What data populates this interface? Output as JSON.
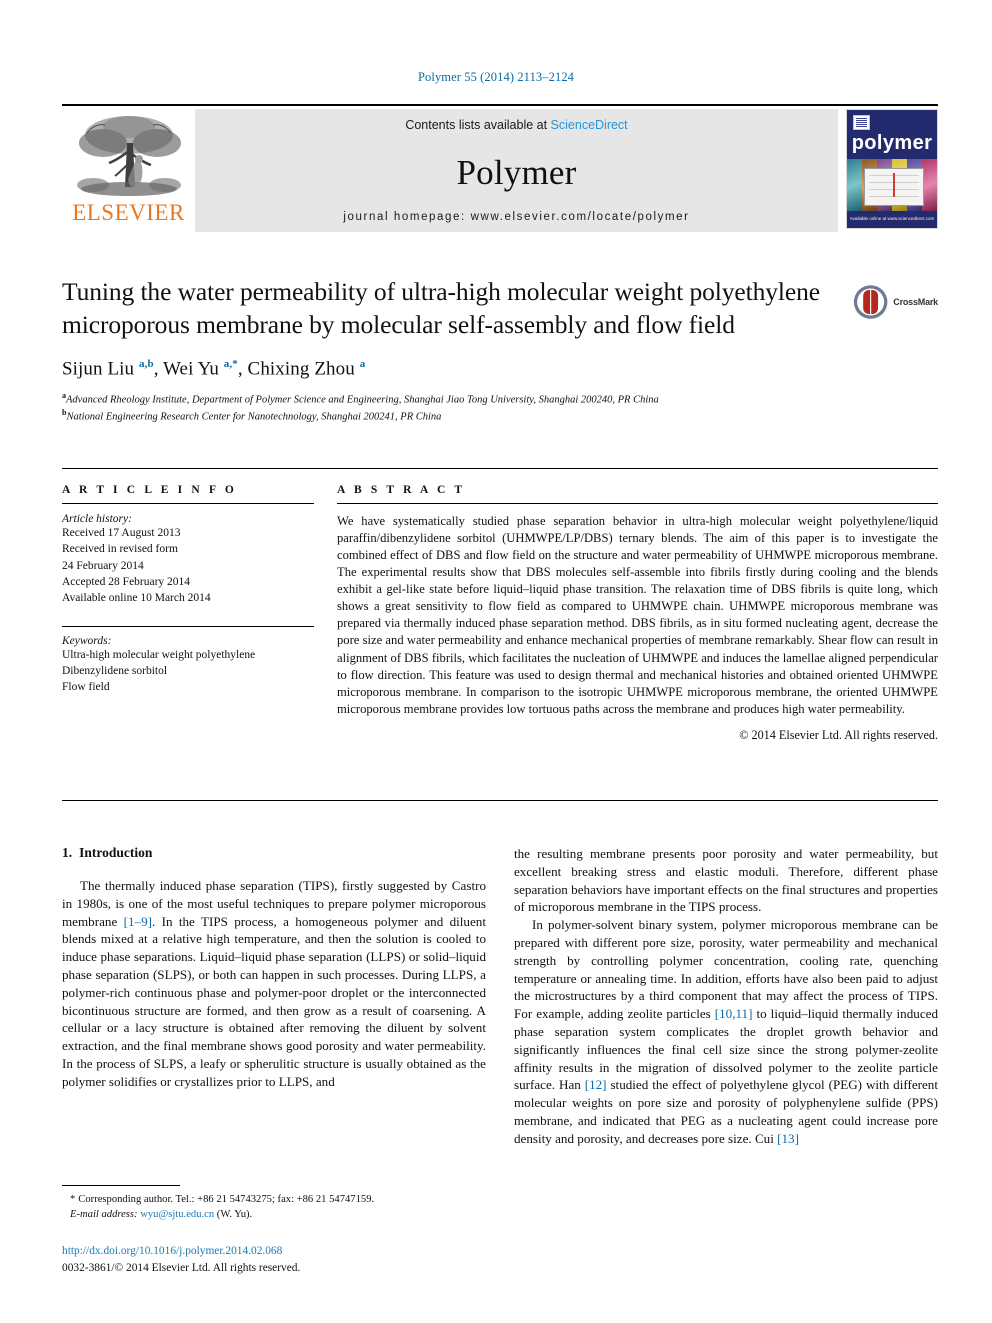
{
  "running_head": "Polymer 55 (2014) 2113–2124",
  "masthead": {
    "publisher_name": "ELSEVIER",
    "contents_prefix": "Contents lists available at ",
    "contents_link": "ScienceDirect",
    "journal_name": "Polymer",
    "homepage": "journal homepage: www.elsevier.com/locate/polymer",
    "cover_title": "polymer",
    "cover_footer": "Available online at www.sciencedirect.com"
  },
  "article": {
    "title": "Tuning the water permeability of ultra-high molecular weight polyethylene microporous membrane by molecular self-assembly and flow field",
    "crossmark_label": "CrossMark",
    "authors_html": "Sijun Liu <sup>a,b</sup>, Wei Yu <sup>a,*</sup>, Chixing Zhou <sup>a</sup>",
    "affiliations": [
      {
        "marker": "a",
        "text": "Advanced Rheology Institute, Department of Polymer Science and Engineering, Shanghai Jiao Tong University, Shanghai 200240, PR China"
      },
      {
        "marker": "b",
        "text": "National Engineering Research Center for Nanotechnology, Shanghai 200241, PR China"
      }
    ]
  },
  "article_info": {
    "heading": "A R T I C L E  I N F O",
    "history_label": "Article history:",
    "history_lines": [
      "Received 17 August 2013",
      "Received in revised form",
      "24 February 2014",
      "Accepted 28 February 2014",
      "Available online 10 March 2014"
    ],
    "keywords_label": "Keywords:",
    "keywords": [
      "Ultra-high molecular weight polyethylene",
      "Dibenzylidene sorbitol",
      "Flow field"
    ]
  },
  "abstract": {
    "heading": "A B S T R A C T",
    "text": "We have systematically studied phase separation behavior in ultra-high molecular weight polyethylene/liquid paraffin/dibenzylidene sorbitol (UHMWPE/LP/DBS) ternary blends. The aim of this paper is to investigate the combined effect of DBS and flow field on the structure and water permeability of UHMWPE microporous membrane. The experimental results show that DBS molecules self-assemble into fibrils firstly during cooling and the blends exhibit a gel-like state before liquid–liquid phase transition. The relaxation time of DBS fibrils is quite long, which shows a great sensitivity to flow field as compared to UHMWPE chain. UHMWPE microporous membrane was prepared via thermally induced phase separation method. DBS fibrils, as in situ formed nucleating agent, decrease the pore size and water permeability and enhance mechanical properties of membrane remarkably. Shear flow can result in alignment of DBS fibrils, which facilitates the nucleation of UHMWPE and induces the lamellae aligned perpendicular to flow direction. This feature was used to design thermal and mechanical histories and obtained oriented UHMWPE microporous membrane. In comparison to the isotropic UHMWPE microporous membrane, the oriented UHMWPE microporous membrane provides low tortuous paths across the membrane and produces high water permeability.",
    "copyright": "© 2014 Elsevier Ltd. All rights reserved."
  },
  "introduction": {
    "number": "1.",
    "heading": "Introduction",
    "left_paragraph_1_a": "The thermally induced phase separation (TIPS), firstly suggested by Castro in 1980s, is one of the most useful techniques to prepare polymer microporous membrane ",
    "left_ref_1": "[1–9]",
    "left_paragraph_1_b": ". In the TIPS process, a homogeneous polymer and diluent blends mixed at a relative high temperature, and then the solution is cooled to induce phase separations. Liquid–liquid phase separation (LLPS) or solid–liquid phase separation (SLPS), or both can happen in such processes. During LLPS, a polymer-rich continuous phase and polymer-poor droplet or the interconnected bicontinuous structure are formed, and then grow as a result of coarsening. A cellular or a lacy structure is obtained after removing the diluent by solvent extraction, and the final membrane shows good porosity and water permeability. In the process of SLPS, a leafy or spherulitic structure is usually obtained as the polymer solidifies or crystallizes prior to LLPS, and",
    "right_paragraph_1": "the resulting membrane presents poor porosity and water permeability, but excellent breaking stress and elastic moduli. Therefore, different phase separation behaviors have important effects on the final structures and properties of microporous membrane in the TIPS process.",
    "right_paragraph_2_a": "In polymer-solvent binary system, polymer microporous membrane can be prepared with different pore size, porosity, water permeability and mechanical strength by controlling polymer concentration, cooling rate, quenching temperature or annealing time. In addition, efforts have also been paid to adjust the microstructures by a third component that may affect the process of TIPS. For example, adding zeolite particles ",
    "right_ref_1": "[10,11]",
    "right_paragraph_2_b": " to liquid–liquid thermally induced phase separation system complicates the droplet growth behavior and significantly influences the final cell size since the strong polymer-zeolite affinity results in the migration of dissolved polymer to the zeolite particle surface. Han ",
    "right_ref_2": "[12]",
    "right_paragraph_2_c": " studied the effect of polyethylene glycol (PEG) with different molecular weights on pore size and porosity of polyphenylene sulfide (PPS) membrane, and indicated that PEG as a nucleating agent could increase pore density and porosity, and decreases pore size. Cui ",
    "right_ref_3": "[13]"
  },
  "footnote": {
    "star": "*",
    "corresponding": "Corresponding author. Tel.: +86 21 54743275; fax: +86 21 54747159.",
    "email_label": "E-mail address:",
    "email": "wyu@sjtu.edu.cn",
    "email_suffix": "(W. Yu)."
  },
  "footer": {
    "doi": "http://dx.doi.org/10.1016/j.polymer.2014.02.068",
    "issn": "0032-3861/© 2014 Elsevier Ltd. All rights reserved."
  },
  "colors": {
    "link_blue": "#1b7bb8",
    "sciencedirect_blue": "#2a93d5",
    "elsevier_orange": "#e87722",
    "cover_navy": "#232a6e",
    "crossmark_red": "#b5281e"
  }
}
